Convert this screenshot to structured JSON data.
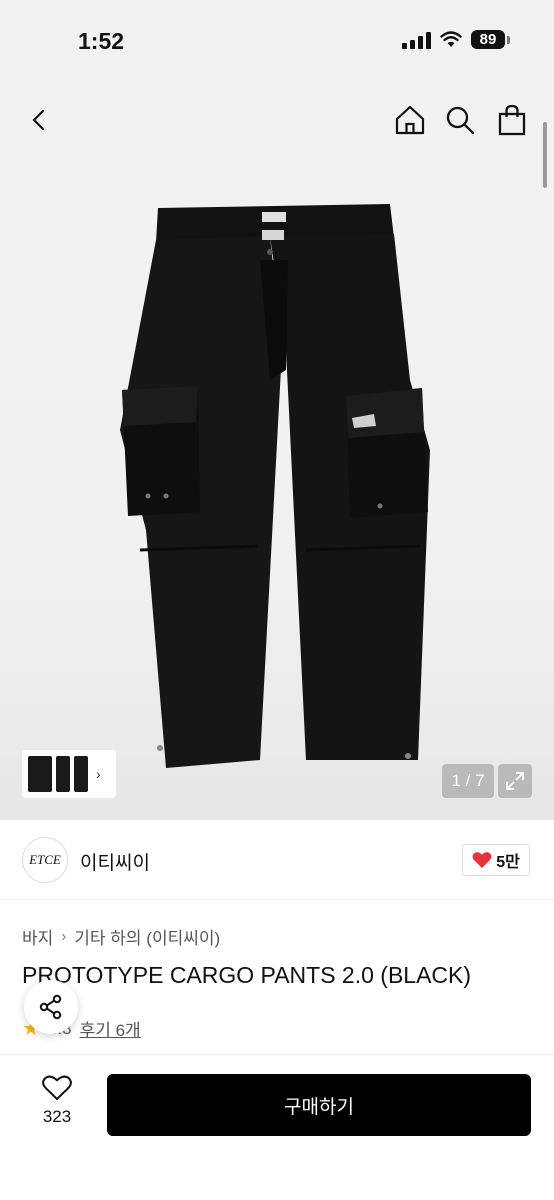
{
  "status_bar": {
    "time": "1:52",
    "battery": "89"
  },
  "gallery": {
    "counter": "1 / 7"
  },
  "brand": {
    "logo_text": "ETCE",
    "name": "이티씨이",
    "likes": "5만"
  },
  "breadcrumb": {
    "category": "바지",
    "subcategory": "기타 하의 (이티씨이)"
  },
  "product": {
    "title": "PROTOTYPE CARGO PANTS 2.0 (BLACK)",
    "rating": "4.8",
    "reviews": "후기 6개"
  },
  "bottom_bar": {
    "wish_count": "323",
    "buy_label": "구매하기"
  },
  "colors": {
    "accent": "#000000",
    "heart": "#e8323c",
    "star": "#f4b41a"
  },
  "icons": [
    "back-icon",
    "home-icon",
    "search-icon",
    "bag-icon",
    "expand-icon",
    "heart-icon",
    "star-icon",
    "share-icon",
    "chevron-right-icon"
  ]
}
